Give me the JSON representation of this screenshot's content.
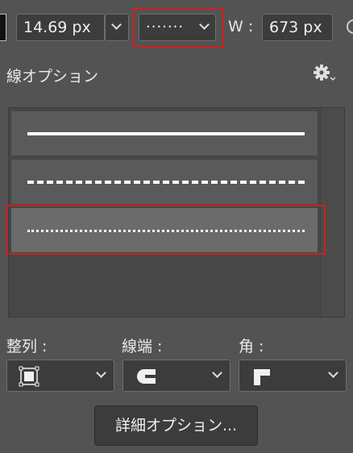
{
  "toolbar": {
    "stroke_width": "14.69 px",
    "stroke_type_preview": "·······",
    "width_label": "W :",
    "width_value": "673 px"
  },
  "panel": {
    "title": "線オプション",
    "presets": [
      {
        "name": "solid"
      },
      {
        "name": "dashed"
      },
      {
        "name": "dotted",
        "selected": true
      }
    ]
  },
  "options": {
    "align_label": "整列 :",
    "caps_label": "線端 :",
    "corners_label": "角 :",
    "align_icon": "align-center-icon",
    "caps_icon": "round-cap-icon",
    "corners_icon": "miter-corner-icon"
  },
  "more_options_button": "詳細オプション...",
  "colors": {
    "background": "#535353",
    "field": "#3c3c3c",
    "highlight": "#d01f1f"
  }
}
